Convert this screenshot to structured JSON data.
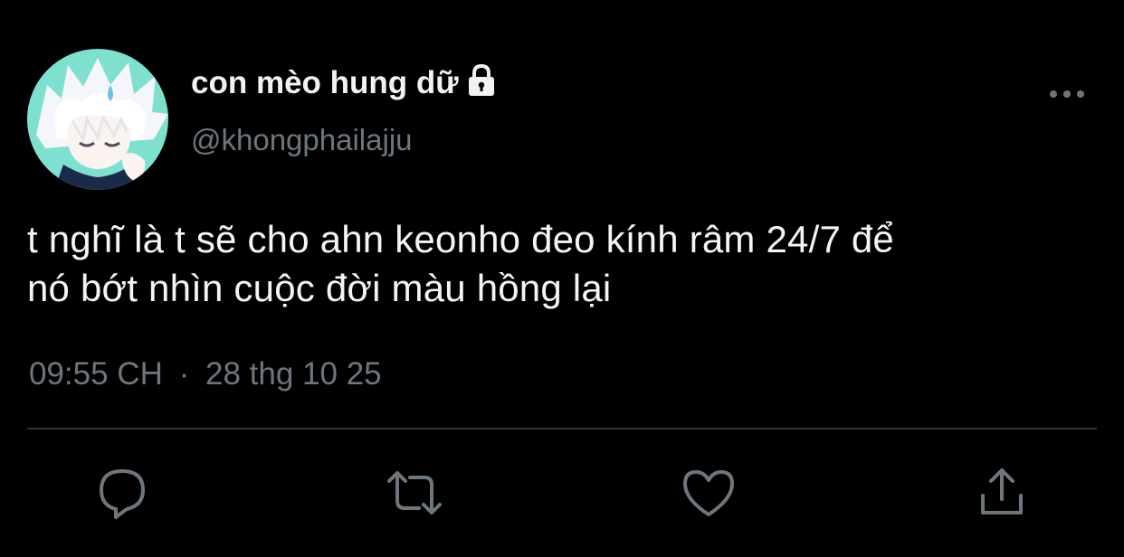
{
  "tweet": {
    "author": {
      "display_name": "con mèo hung dữ",
      "handle": "@khongphailajju",
      "protected_icon": "lock-icon",
      "avatar": "avatar"
    },
    "text_line1": "t nghĩ là t sẽ cho ahn keonho đeo kính râm 24/7 để",
    "text_line2": "nó bớt nhìn cuộc đời màu hồng lại",
    "time": "09:55 CH",
    "separator": "·",
    "date": "28 thg 10 25",
    "menu_icon": "more-icon"
  },
  "actions": [
    {
      "name": "reply",
      "icon": "reply-icon"
    },
    {
      "name": "retweet",
      "icon": "retweet-icon"
    },
    {
      "name": "like",
      "icon": "heart-icon"
    },
    {
      "name": "share",
      "icon": "share-icon"
    }
  ],
  "colors": {
    "background": "#000000",
    "primary_text": "#f5f5f5",
    "secondary_text": "#6e767d",
    "divider": "#2f3336",
    "icon": "#6e767d"
  }
}
